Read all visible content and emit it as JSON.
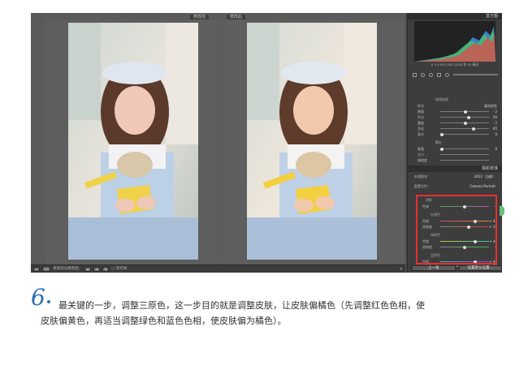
{
  "compare": {
    "before_label": "修改前",
    "after_label": "修改后"
  },
  "toolbar": {
    "view_mode_label": "Y|Y",
    "compare_text": "修改前与修改后：",
    "soft_proof_text": "软打样"
  },
  "right_panel": {
    "histogram_title": "直方图",
    "histogram_info": "ƒ/ 4.5  ISO 100  1/250 秒  50 毫米",
    "detail_section": {
      "title": "暗角效果",
      "rows": [
        {
          "label": "样式",
          "value": "高光优先"
        },
        {
          "label": "数量",
          "value": "- 2"
        },
        {
          "label": "中点",
          "value": "56"
        },
        {
          "label": "圆度",
          "value": "- 2"
        },
        {
          "label": "羽化",
          "value": "65"
        },
        {
          "label": "高光",
          "value": "0"
        }
      ]
    },
    "grain_section": {
      "title": "颗粒",
      "rows": [
        {
          "label": "数量",
          "value": "0"
        },
        {
          "label": "大小",
          "value": ""
        },
        {
          "label": "粗糙度",
          "value": ""
        }
      ]
    },
    "camera_calibration_title": "相机校准",
    "process_label": "处理版本：",
    "process_value": "2012（当前）",
    "profile_label": "配置文件：",
    "profile_value": "Camera Portrait",
    "shadows": {
      "title": "阴影",
      "rows": [
        {
          "label": "色调",
          "value": "0"
        }
      ]
    },
    "red_primary": {
      "title": "红原色",
      "rows": [
        {
          "label": "色相",
          "value": "+ 44"
        },
        {
          "label": "饱和度",
          "value": "+ 16"
        }
      ]
    },
    "green_primary": {
      "title": "绿原色",
      "rows": [
        {
          "label": "色相",
          "value": "+ 46"
        },
        {
          "label": "饱和度",
          "value": "0"
        }
      ]
    },
    "blue_primary": {
      "title": "蓝原色",
      "rows": [
        {
          "label": "色相",
          "value": "+ 44"
        },
        {
          "label": "饱和度",
          "value": "+ 33"
        }
      ]
    },
    "prev_button": "上一张",
    "reset_button": "设置默认设置..."
  },
  "caption": {
    "step_number": "6",
    "line1": "最关键的一步，调整三原色，这一步目的就是调整皮肤，让皮肤偏橘色（先调整红色色相，使",
    "line2": "皮肤偏黄色，再适当调整绿色和蓝色色相，使皮肤偏为橘色）。"
  },
  "colors": {
    "highlight_box": "#e5302f",
    "step_number": "#2c6fb0"
  }
}
